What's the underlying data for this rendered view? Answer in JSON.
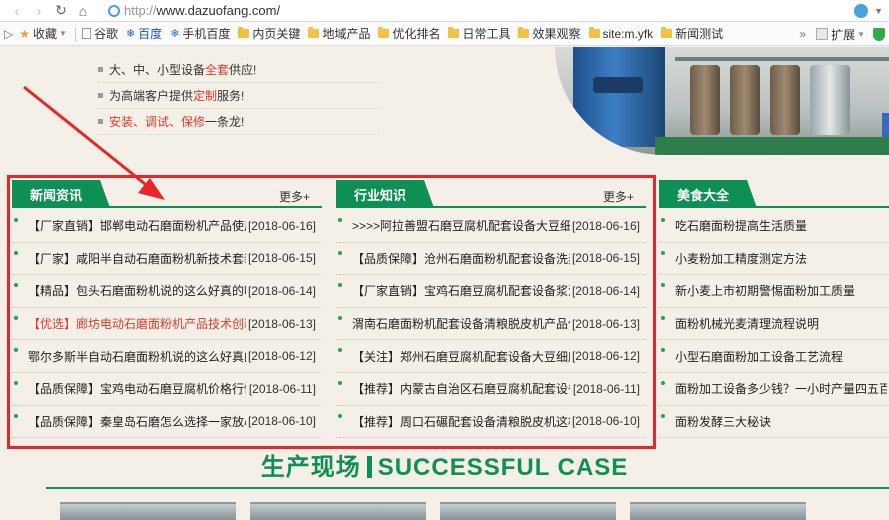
{
  "browser": {
    "url_protocol": "http://",
    "url_host": "www.dazuofang.com/"
  },
  "bookmarks": {
    "items": [
      {
        "label": "收藏",
        "icon": "star-icon"
      },
      {
        "label": "谷歌",
        "icon": "doc-icon"
      },
      {
        "label": "百度",
        "icon": "baidu-paw-icon"
      },
      {
        "label": "手机百度",
        "icon": "baidu-paw-icon"
      },
      {
        "label": "内页关键",
        "icon": "folder-icon"
      },
      {
        "label": "地域产品",
        "icon": "folder-icon"
      },
      {
        "label": "优化排名",
        "icon": "folder-icon"
      },
      {
        "label": "日常工具",
        "icon": "folder-icon"
      },
      {
        "label": "效果观察",
        "icon": "folder-icon"
      },
      {
        "label": "site:m.yfk",
        "icon": "folder-icon"
      },
      {
        "label": "新闻测试",
        "icon": "folder-icon"
      }
    ],
    "more": "»",
    "extensions_label": "扩展"
  },
  "slogans": [
    {
      "pre": "大、中、小型设备",
      "red": "全套",
      "post": "供应!"
    },
    {
      "pre": "为高端客户提供",
      "red": "定制",
      "post": "服务!"
    },
    {
      "pre": "",
      "red": "安装、调试、保修",
      "post": "一条龙!"
    }
  ],
  "columns": {
    "news": {
      "tab": "新闻资讯",
      "more": "更多+",
      "items": [
        {
          "title": "【厂家直销】邯郸电动石磨面粉机产品使用",
          "date": "[2018-06-16]",
          "red": false
        },
        {
          "title": "【厂家】咸阳半自动石磨面粉机新技术套装",
          "date": "[2018-06-15]",
          "red": false
        },
        {
          "title": "【精品】包头石磨面粉机说的这么好真的吗",
          "date": "[2018-06-14]",
          "red": false
        },
        {
          "title": "【优选】廊坊电动石磨面粉机产品技术创新",
          "date": "[2018-06-13]",
          "red": true
        },
        {
          "title": "鄂尔多斯半自动石磨面粉机说的这么好真的",
          "date": "[2018-06-12]",
          "red": false
        },
        {
          "title": "【品质保障】宝鸡电动石磨豆腐机价格行情",
          "date": "[2018-06-11]",
          "red": false
        },
        {
          "title": "【品质保障】秦皇岛石磨怎么选择一家放心",
          "date": "[2018-06-10]",
          "red": false
        }
      ]
    },
    "knowledge": {
      "tab": "行业知识",
      "more": "更多+",
      "items": [
        {
          "title": ">>>>阿拉善盟石磨豆腐机配套设备大豆细磨",
          "date": "[2018-06-16]"
        },
        {
          "title": "【品质保障】沧州石磨面粉机配套设备洗麦",
          "date": "[2018-06-15]"
        },
        {
          "title": "【厂家直销】宝鸡石磨豆腐机配套设备浆渣",
          "date": "[2018-06-14]"
        },
        {
          "title": "渭南石磨面粉机配套设备清粮脱皮机产品使用",
          "date": "[2018-06-13]"
        },
        {
          "title": "【关注】郑州石磨豆腐机配套设备大豆细磨",
          "date": "[2018-06-12]"
        },
        {
          "title": "【推荐】内蒙古自治区石磨豆腐机配套设备",
          "date": "[2018-06-11]"
        },
        {
          "title": "【推荐】周口石碾配套设备清粮脱皮机这样",
          "date": "[2018-06-10]"
        }
      ]
    },
    "food": {
      "tab": "美食大全",
      "items": [
        {
          "title": "吃石磨面粉提高生活质量"
        },
        {
          "title": "小麦粉加工精度测定方法"
        },
        {
          "title": "新小麦上市初期警惕面粉加工质量"
        },
        {
          "title": "面粉机械光麦清理流程说明"
        },
        {
          "title": "小型石磨面粉加工设备工艺流程"
        },
        {
          "title": "面粉加工设备多少钱？一小时产量四五百斤"
        },
        {
          "title": "面粉发酵三大秘诀"
        }
      ]
    }
  },
  "case_section": {
    "title_cn": "生产现场",
    "title_en": "SUCCESSFUL CASE"
  },
  "colors": {
    "brand_green": "#0d8f55",
    "highlight_red": "#e8262a",
    "accent_red_text": "#e03a2c"
  }
}
